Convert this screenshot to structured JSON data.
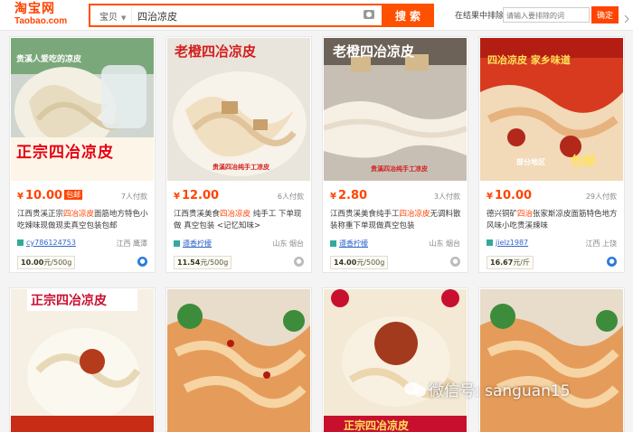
{
  "logo": {
    "line1": "淘宝网",
    "line2": "Taobao.com"
  },
  "search": {
    "scope": "宝贝",
    "query": "四治凉皮",
    "button": "搜索"
  },
  "refine": {
    "label": "在结果中排除",
    "placeholder": "请输入要排除的词",
    "button": "确定"
  },
  "accent": "#ff4400",
  "products": [
    {
      "price_symbol": "¥",
      "price": "10.00",
      "free_shipping": "包邮",
      "buyers": "7人付款",
      "title_pre": "江西贵溪正宗",
      "title_hl": "四冶凉皮",
      "title_post": "面筋地方特色小吃辣味现做现卖真空包装包邮",
      "shop": "cy786124753",
      "location": "江西 鹰潭",
      "unit_price": "10.00",
      "unit": "元/500g",
      "image_text": "正宗四冶凉皮",
      "image_caption": "贵溪人爱吃的凉皮"
    },
    {
      "price_symbol": "¥",
      "price": "12.00",
      "free_shipping": "",
      "buyers": "6人付款",
      "title_pre": "江西贵溪美食",
      "title_hl": "四冶凉皮",
      "title_post": " 纯手工 下单现做 真空包装 <记忆知味>",
      "shop": "遵香柠檬",
      "location": "山东 烟台",
      "unit_price": "11.54",
      "unit": "元/500g",
      "image_text": "老橙四冶凉皮",
      "image_caption": "贵溪四冶纯手工凉皮"
    },
    {
      "price_symbol": "¥",
      "price": "2.80",
      "free_shipping": "",
      "buyers": "3人付款",
      "title_pre": "江西贵溪美食纯手工",
      "title_hl": "四冶凉皮",
      "title_post": "无调料散装称重下单现做真空包装",
      "shop": "遵香柠檬",
      "location": "山东 烟台",
      "unit_price": "14.00",
      "unit": "元/500g",
      "image_text": "老橙四冶凉皮",
      "image_caption": "贵溪四冶纯手工凉皮"
    },
    {
      "price_symbol": "¥",
      "price": "10.00",
      "free_shipping": "",
      "buyers": "29人付款",
      "title_pre": "德兴铜矿",
      "title_hl": "四治",
      "title_post": "张家斯凉皮面筋特色地方风味小吃贵溪辣味",
      "shop": "jielz1987",
      "location": "江西 上饶",
      "unit_price": "16.67",
      "unit": "元/斤",
      "image_text": "四冶凉皮 家乡味道",
      "image_caption": "部分地区",
      "image_badge": "包邮"
    }
  ],
  "row2_images": [
    {
      "image_text": "正宗四冶凉皮",
      "image_caption": "正宗四冶凉皮"
    },
    {
      "image_text": "",
      "image_caption": ""
    },
    {
      "image_text": "正宗四冶凉皮",
      "image_caption": "正宗四冶凉皮"
    },
    {
      "image_text": "",
      "image_caption": ""
    }
  ],
  "watermark": "微信号: sanguan15"
}
